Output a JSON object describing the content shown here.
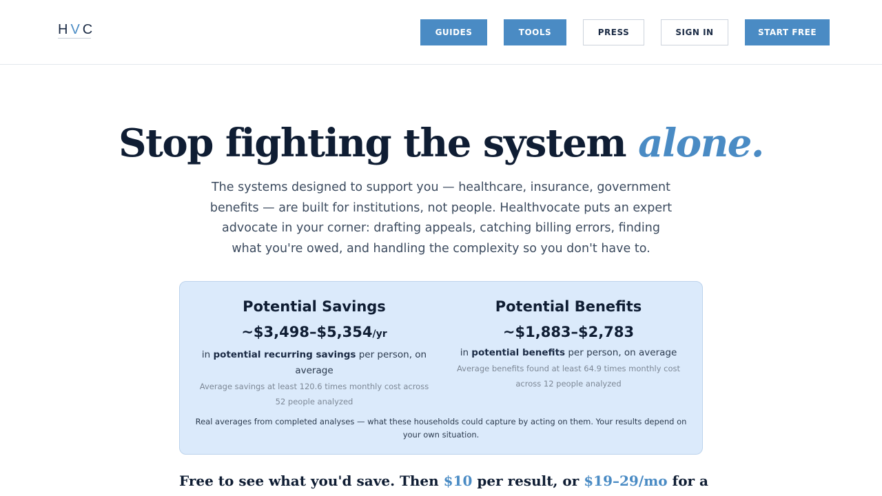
{
  "header": {
    "logo": {
      "part1": "H",
      "part2": "V",
      "part3": "C"
    },
    "nav": [
      {
        "label": "GUIDES",
        "style": "filled"
      },
      {
        "label": "TOOLS",
        "style": "filled"
      },
      {
        "label": "PRESS",
        "style": "outline"
      },
      {
        "label": "SIGN IN",
        "style": "outline"
      },
      {
        "label": "START FREE",
        "style": "filled"
      }
    ]
  },
  "hero": {
    "title_main": "Stop fighting the system ",
    "title_accent": "alone.",
    "subtitle": "The systems designed to support you — healthcare, insurance, government benefits — are built for institutions, not people. Healthvocate puts an expert advocate in your corner: drafting appeals, catching billing errors, finding what you're owed, and handling the complexity so you don't have to."
  },
  "stats": {
    "savings": {
      "title": "Potential Savings",
      "value": "~$3,498–$5,354",
      "unit": "/yr",
      "desc_prefix": "in ",
      "desc_bold": "potential recurring savings",
      "desc_suffix": " per person, on average",
      "note": "Average savings at least 120.6 times monthly cost across 52 people analyzed"
    },
    "benefits": {
      "title": "Potential Benefits",
      "value": "~$1,883–$2,783",
      "desc_prefix": "in ",
      "desc_bold": "potential benefits",
      "desc_suffix": " per person, on average",
      "note": "Average benefits found at least 64.9 times monthly cost across 12 people analyzed"
    },
    "footnote": "Real averages from completed analyses — what these households could capture by acting on them. Your results depend on your own situation."
  },
  "pricing": {
    "part1": "Free to see what you'd save. Then ",
    "price1": "$10",
    "part2": " per result, or ",
    "price2": "$19–29/mo",
    "part3": " for a"
  },
  "colors": {
    "accent": "#4a8bc4",
    "card_bg": "#dbeafb",
    "heading": "#0f1d33"
  }
}
